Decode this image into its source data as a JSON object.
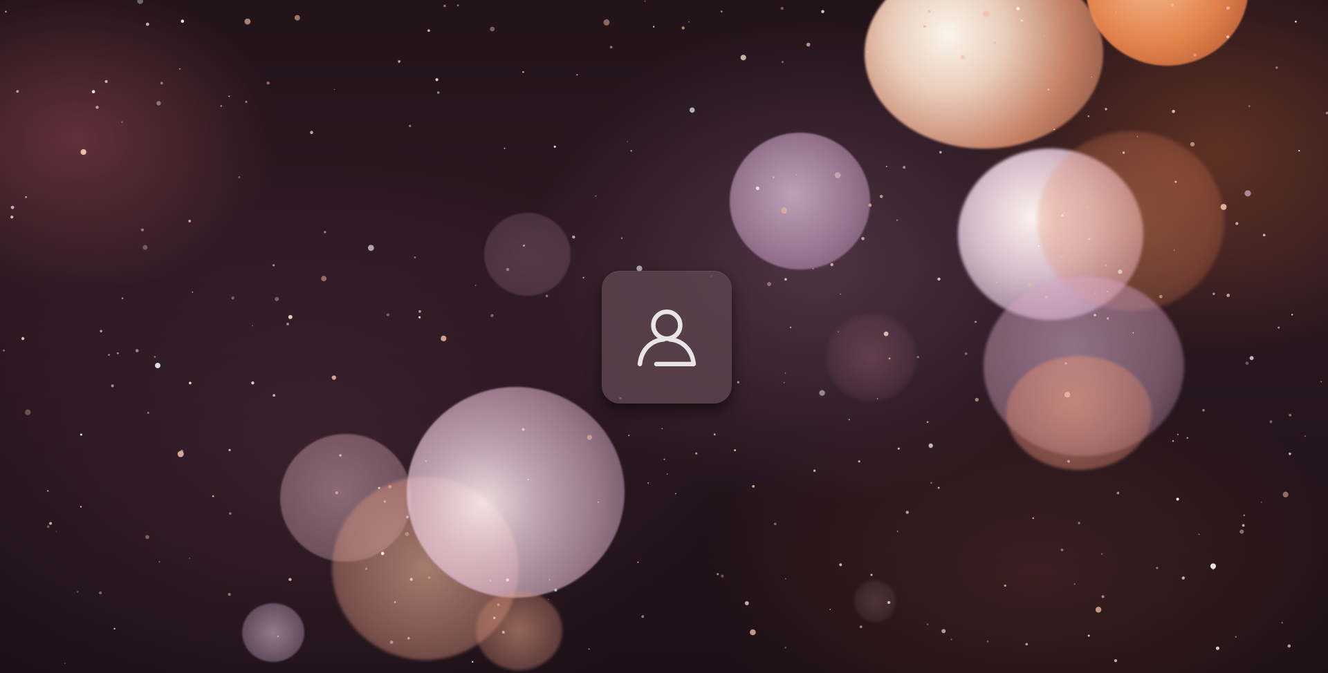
{
  "screen": {
    "type": "lock-screen",
    "background": "bokeh-particles"
  },
  "account": {
    "avatar_icon": "user-icon",
    "icon_color": "#e9e4e6",
    "tile_color": "#5f4650"
  },
  "colors": {
    "background_dark": "#1a0f14",
    "bokeh_lavender": "#e7c8dd",
    "bokeh_peach": "#f6b99a",
    "bokeh_orange": "#f08a4a"
  }
}
